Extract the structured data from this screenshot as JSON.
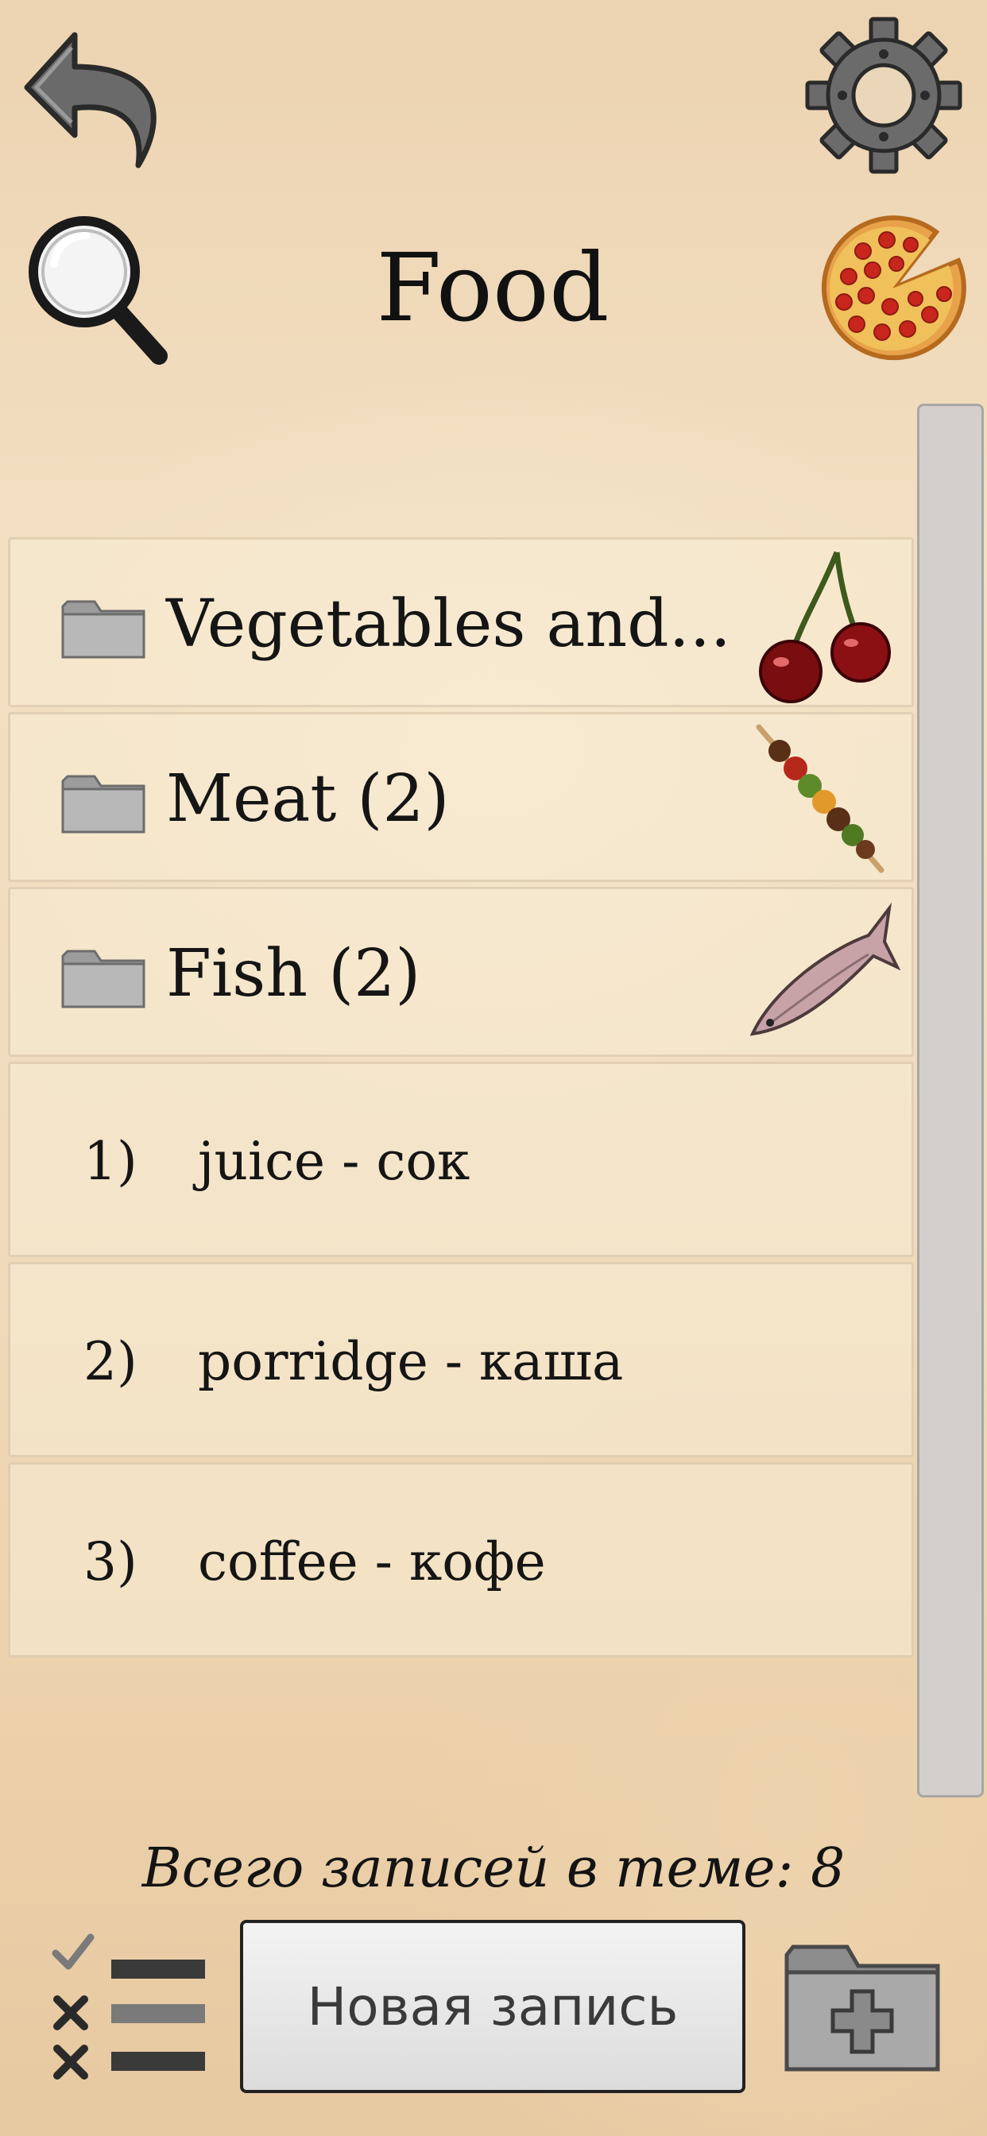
{
  "header": {
    "title": "Food",
    "back_icon": "back-arrow-icon",
    "settings_icon": "gear-icon",
    "search_icon": "magnifier-icon",
    "topic_icon": "pizza-icon"
  },
  "list": {
    "folders": [
      {
        "label": "Vegetables and...",
        "icon": "cherry-icon"
      },
      {
        "label": "Meat (2)",
        "icon": "kebab-icon"
      },
      {
        "label": "Fish (2)",
        "icon": "fish-icon"
      }
    ],
    "entries": [
      {
        "number": "1)",
        "text": "juice - сок"
      },
      {
        "number": "2)",
        "text": "porridge - каша"
      },
      {
        "number": "3)",
        "text": "coffee - кофе"
      }
    ]
  },
  "footer": {
    "total_text": "Всего записей в теме: 8",
    "new_entry_label": "Новая запись",
    "checklist_icon": "checklist-icon",
    "add_folder_icon": "add-folder-icon"
  },
  "colors": {
    "text": "#151515",
    "scrollbar": "#d3cfcd",
    "button_border": "#222222"
  }
}
